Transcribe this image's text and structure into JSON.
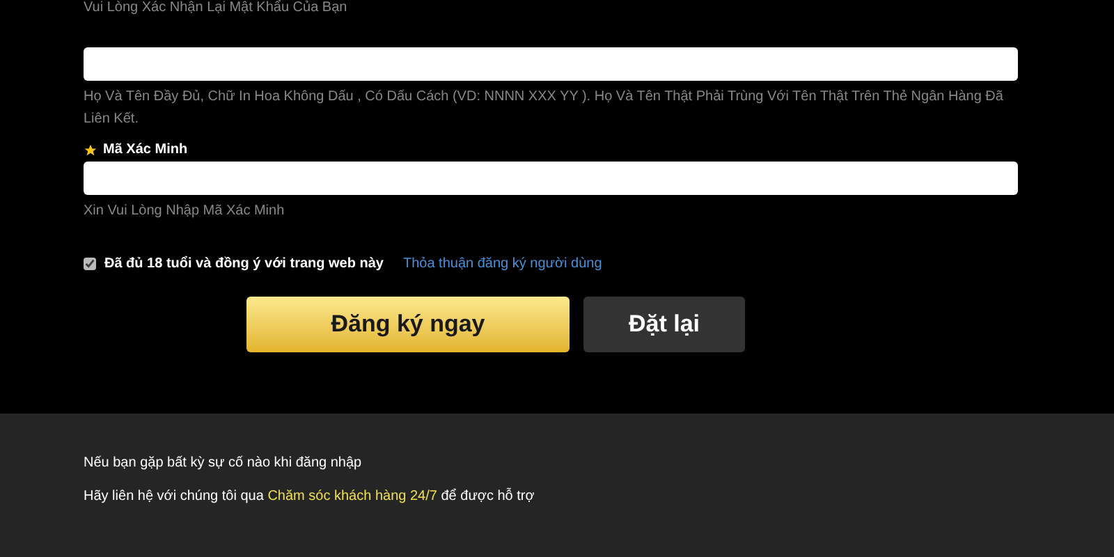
{
  "top_hint": "Vui Lòng Xác Nhận Lại Mật Khẩu Của Bạn",
  "fields": [
    {
      "hint": "Họ Và Tên Đầy Đủ, Chữ In Hoa Không Dấu , Có Dấu Cách (VD: NNNN XXX YY ). Họ Và Tên Thật Phải Trùng Với Tên Thật Trên Thẻ Ngân Hàng Đã Liên Kết."
    },
    {
      "label": "Mã Xác Minh",
      "hint": "Xin Vui Lòng Nhập Mã Xác Minh"
    }
  ],
  "agreement": {
    "checked": true,
    "label": "Đã đủ 18 tuổi và đồng ý với trang web này",
    "link": "Thỏa thuận đăng ký người dùng"
  },
  "buttons": [
    {
      "kind": "primary",
      "label": "Đăng ký ngay"
    },
    {
      "kind": "secondary",
      "label": "Đặt lại"
    }
  ],
  "footer": {
    "line_1": "Nếu bạn gặp bất kỳ sự cố nào khi đăng nhập",
    "line_2_before": "Hãy liên hệ với chúng tôi qua",
    "line_2_link": "Chăm sóc khách hàng 24/7",
    "line_2_after": "để được hỗ trợ"
  }
}
